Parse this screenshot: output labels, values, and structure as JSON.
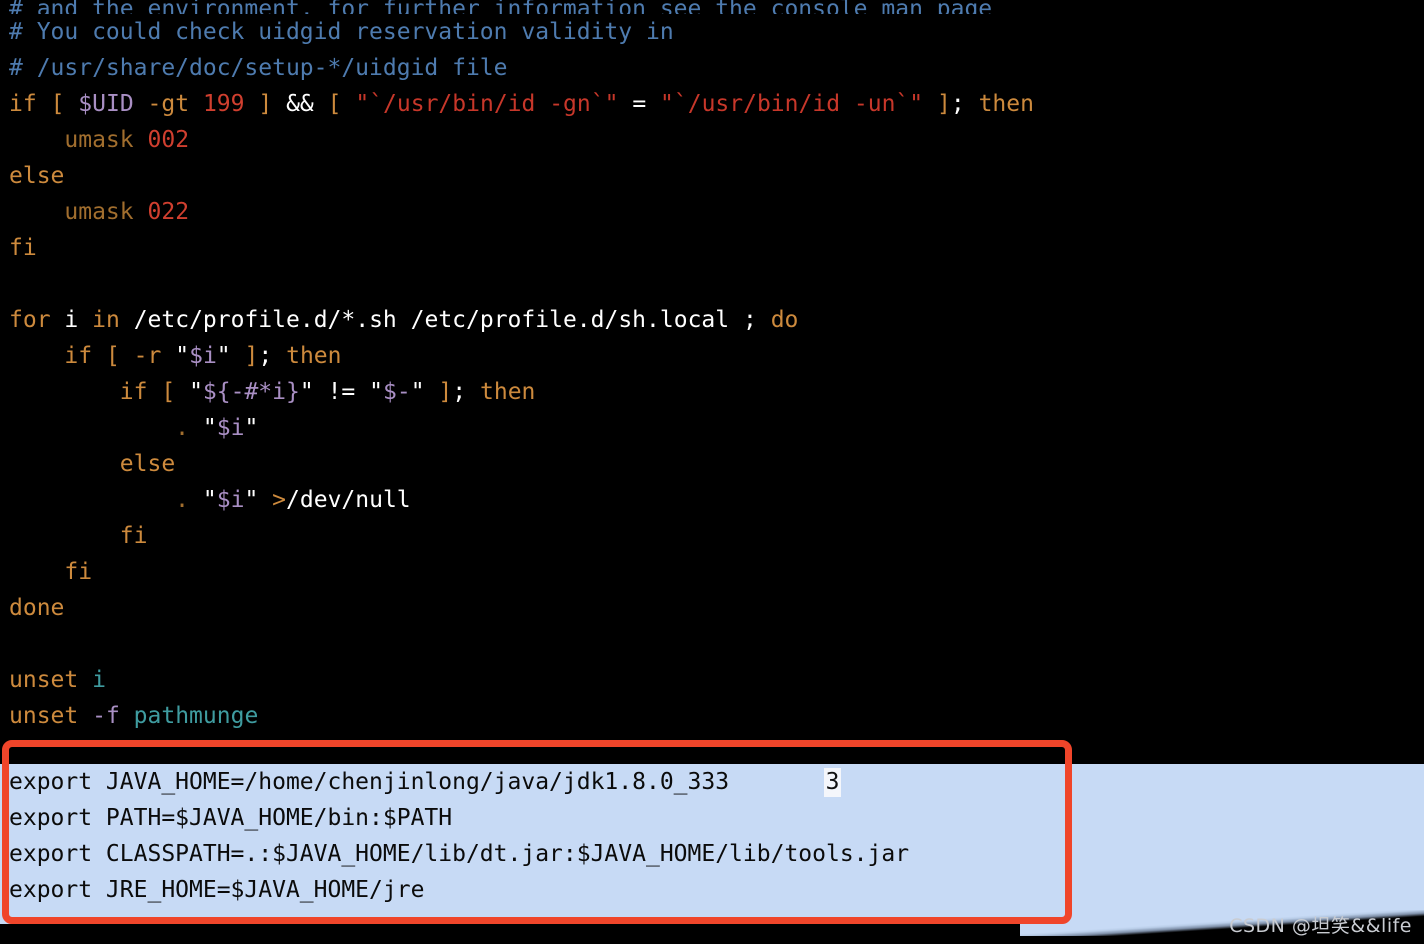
{
  "terminal": {
    "background": "#000000",
    "foreground": "#ffffff",
    "font_size_px": 23,
    "line_height_px": 36
  },
  "colors": {
    "comment": "#4e7baf",
    "keyword": "#cd8a3d",
    "builtin": "#a16e2e",
    "number": "#d03f2f",
    "string": "#c7372a",
    "variable": "#a98fc4",
    "identifier": "#3f9ca0",
    "plain": "#ffffff",
    "selection_bg": "#c7daf5",
    "selection_fg": "#0b0b0b",
    "annotation_border": "#f0452a",
    "cursor_bg": "#f4f6fb"
  },
  "code": {
    "clipped_first_line": "# and the environment, for further information see the console man page",
    "lines": [
      {
        "indent": 0,
        "tokens": [
          {
            "text": "# You could check uidgid reservation validity in",
            "cls": "t-comment"
          }
        ]
      },
      {
        "indent": 0,
        "tokens": [
          {
            "text": "# /usr/share/doc/setup-*/uidgid file",
            "cls": "t-comment"
          }
        ]
      },
      {
        "indent": 0,
        "tokens": [
          {
            "text": "if",
            "cls": "t-keyword"
          },
          {
            "text": " ",
            "cls": "t-plain"
          },
          {
            "text": "[",
            "cls": "t-punct"
          },
          {
            "text": " ",
            "cls": "t-plain"
          },
          {
            "text": "$UID",
            "cls": "t-var"
          },
          {
            "text": " ",
            "cls": "t-plain"
          },
          {
            "text": "-gt",
            "cls": "t-keyword"
          },
          {
            "text": " ",
            "cls": "t-plain"
          },
          {
            "text": "199",
            "cls": "t-number"
          },
          {
            "text": " ",
            "cls": "t-plain"
          },
          {
            "text": "]",
            "cls": "t-punct"
          },
          {
            "text": " ",
            "cls": "t-plain"
          },
          {
            "text": "&&",
            "cls": "t-op"
          },
          {
            "text": " ",
            "cls": "t-plain"
          },
          {
            "text": "[",
            "cls": "t-punct"
          },
          {
            "text": " ",
            "cls": "t-plain"
          },
          {
            "text": "\"`/usr/bin/id -gn`\"",
            "cls": "t-string"
          },
          {
            "text": " ",
            "cls": "t-plain"
          },
          {
            "text": "=",
            "cls": "t-op"
          },
          {
            "text": " ",
            "cls": "t-plain"
          },
          {
            "text": "\"`/usr/bin/id -un`\"",
            "cls": "t-string"
          },
          {
            "text": " ",
            "cls": "t-plain"
          },
          {
            "text": "]",
            "cls": "t-punct"
          },
          {
            "text": ";",
            "cls": "t-plain"
          },
          {
            "text": " ",
            "cls": "t-plain"
          },
          {
            "text": "then",
            "cls": "t-keyword"
          }
        ]
      },
      {
        "indent": 4,
        "tokens": [
          {
            "text": "umask",
            "cls": "t-builtin"
          },
          {
            "text": " ",
            "cls": "t-plain"
          },
          {
            "text": "002",
            "cls": "t-number"
          }
        ]
      },
      {
        "indent": 0,
        "tokens": [
          {
            "text": "else",
            "cls": "t-keyword"
          }
        ]
      },
      {
        "indent": 4,
        "tokens": [
          {
            "text": "umask",
            "cls": "t-builtin"
          },
          {
            "text": " ",
            "cls": "t-plain"
          },
          {
            "text": "022",
            "cls": "t-number"
          }
        ]
      },
      {
        "indent": 0,
        "tokens": [
          {
            "text": "fi",
            "cls": "t-keyword"
          }
        ]
      },
      {
        "indent": 0,
        "tokens": []
      },
      {
        "indent": 0,
        "tokens": [
          {
            "text": "for",
            "cls": "t-keyword"
          },
          {
            "text": " ",
            "cls": "t-plain"
          },
          {
            "text": "i",
            "cls": "t-plain"
          },
          {
            "text": " ",
            "cls": "t-plain"
          },
          {
            "text": "in",
            "cls": "t-keyword"
          },
          {
            "text": " ",
            "cls": "t-plain"
          },
          {
            "text": "/etc/profile.d/*.sh /etc/profile.d/sh.local ",
            "cls": "t-plain"
          },
          {
            "text": ";",
            "cls": "t-plain"
          },
          {
            "text": " ",
            "cls": "t-plain"
          },
          {
            "text": "do",
            "cls": "t-keyword"
          }
        ]
      },
      {
        "indent": 4,
        "tokens": [
          {
            "text": "if",
            "cls": "t-keyword"
          },
          {
            "text": " ",
            "cls": "t-plain"
          },
          {
            "text": "[",
            "cls": "t-punct"
          },
          {
            "text": " ",
            "cls": "t-plain"
          },
          {
            "text": "-r",
            "cls": "t-keyword"
          },
          {
            "text": " ",
            "cls": "t-plain"
          },
          {
            "text": "\"",
            "cls": "t-plain"
          },
          {
            "text": "$i",
            "cls": "t-var"
          },
          {
            "text": "\"",
            "cls": "t-plain"
          },
          {
            "text": " ",
            "cls": "t-plain"
          },
          {
            "text": "]",
            "cls": "t-punct"
          },
          {
            "text": ";",
            "cls": "t-plain"
          },
          {
            "text": " ",
            "cls": "t-plain"
          },
          {
            "text": "then",
            "cls": "t-keyword"
          }
        ]
      },
      {
        "indent": 8,
        "tokens": [
          {
            "text": "if",
            "cls": "t-keyword"
          },
          {
            "text": " ",
            "cls": "t-plain"
          },
          {
            "text": "[",
            "cls": "t-punct"
          },
          {
            "text": " ",
            "cls": "t-plain"
          },
          {
            "text": "\"",
            "cls": "t-plain"
          },
          {
            "text": "${-#*i}",
            "cls": "t-var"
          },
          {
            "text": "\"",
            "cls": "t-plain"
          },
          {
            "text": " ",
            "cls": "t-plain"
          },
          {
            "text": "!=",
            "cls": "t-plain"
          },
          {
            "text": " ",
            "cls": "t-plain"
          },
          {
            "text": "\"",
            "cls": "t-plain"
          },
          {
            "text": "$-",
            "cls": "t-var"
          },
          {
            "text": "\"",
            "cls": "t-plain"
          },
          {
            "text": " ",
            "cls": "t-plain"
          },
          {
            "text": "]",
            "cls": "t-punct"
          },
          {
            "text": ";",
            "cls": "t-plain"
          },
          {
            "text": " ",
            "cls": "t-plain"
          },
          {
            "text": "then",
            "cls": "t-keyword"
          }
        ]
      },
      {
        "indent": 12,
        "tokens": [
          {
            "text": ".",
            "cls": "t-builtin"
          },
          {
            "text": " ",
            "cls": "t-plain"
          },
          {
            "text": "\"",
            "cls": "t-plain"
          },
          {
            "text": "$i",
            "cls": "t-var"
          },
          {
            "text": "\"",
            "cls": "t-plain"
          }
        ]
      },
      {
        "indent": 8,
        "tokens": [
          {
            "text": "else",
            "cls": "t-keyword"
          }
        ]
      },
      {
        "indent": 12,
        "tokens": [
          {
            "text": ".",
            "cls": "t-builtin"
          },
          {
            "text": " ",
            "cls": "t-plain"
          },
          {
            "text": "\"",
            "cls": "t-plain"
          },
          {
            "text": "$i",
            "cls": "t-var"
          },
          {
            "text": "\"",
            "cls": "t-plain"
          },
          {
            "text": " ",
            "cls": "t-plain"
          },
          {
            "text": ">",
            "cls": "t-keyword"
          },
          {
            "text": "/dev/null",
            "cls": "t-plain"
          }
        ]
      },
      {
        "indent": 8,
        "tokens": [
          {
            "text": "fi",
            "cls": "t-keyword"
          }
        ]
      },
      {
        "indent": 4,
        "tokens": [
          {
            "text": "fi",
            "cls": "t-keyword"
          }
        ]
      },
      {
        "indent": 0,
        "tokens": [
          {
            "text": "done",
            "cls": "t-keyword"
          }
        ]
      },
      {
        "indent": 0,
        "tokens": []
      },
      {
        "indent": 0,
        "tokens": [
          {
            "text": "unset",
            "cls": "t-keyword"
          },
          {
            "text": " ",
            "cls": "t-plain"
          },
          {
            "text": "i",
            "cls": "t-ident"
          }
        ]
      },
      {
        "indent": 0,
        "tokens": [
          {
            "text": "unset",
            "cls": "t-keyword"
          },
          {
            "text": " ",
            "cls": "t-plain"
          },
          {
            "text": "-f",
            "cls": "t-var"
          },
          {
            "text": " ",
            "cls": "t-plain"
          },
          {
            "text": "pathmunge",
            "cls": "t-ident"
          }
        ]
      }
    ]
  },
  "selection": {
    "lines": [
      "export JAVA_HOME=/home/chenjinlong/java/jdk1.8.0_333",
      "export PATH=$JAVA_HOME/bin:$PATH",
      "export CLASSPATH=.:$JAVA_HOME/lib/dt.jar:$JAVA_HOME/lib/tools.jar",
      "export JRE_HOME=$JAVA_HOME/jre"
    ],
    "cursor_char": "3"
  },
  "annotation": {
    "label": "red-highlight-rectangle"
  },
  "watermark": {
    "text": "CSDN @坦笑&&life"
  }
}
